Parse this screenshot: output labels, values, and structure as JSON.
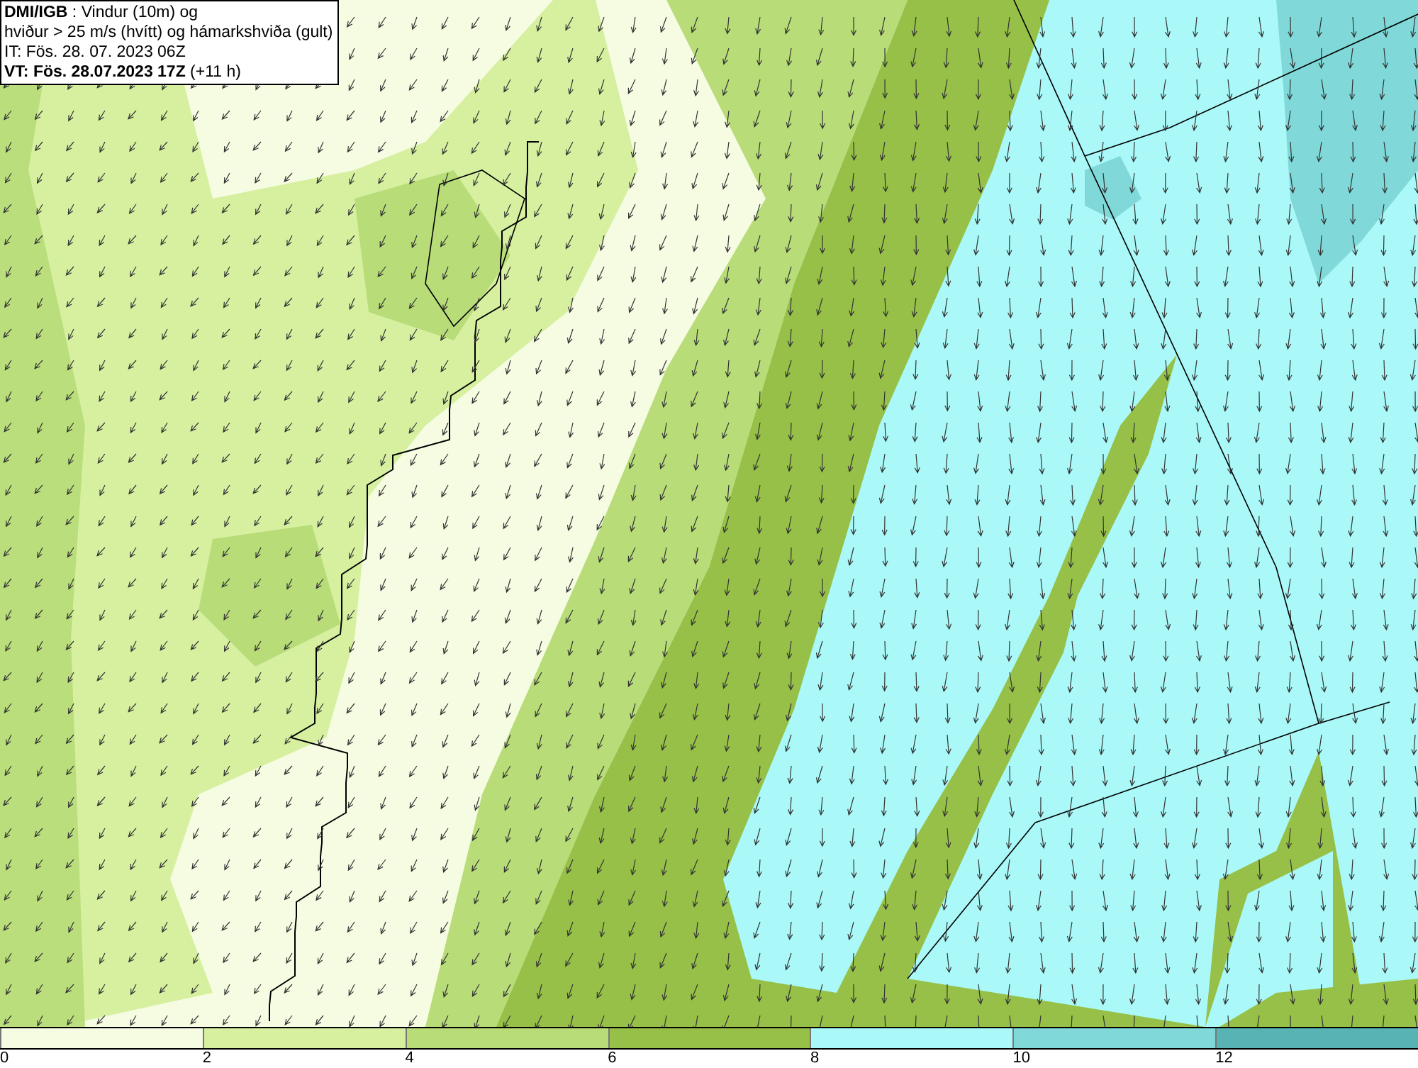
{
  "info_box": {
    "lines": [
      "**DMI/IGB** : Vindur (10m) og",
      "hviður > 25 m/s (hvítt) og hámarkshviða (gult)",
      "IT: Fös. 28. 07. 2023 06Z",
      "**VT: Fös. 28.07.2023 17Z** (+11 h)"
    ]
  },
  "legend": {
    "bins": [
      {
        "color": "#f5fce2"
      },
      {
        "color": "#d6f0a0"
      },
      {
        "color": "#b7dc78"
      },
      {
        "color": "#96c048"
      },
      {
        "color": "#aaf8f8"
      },
      {
        "color": "#80d8d8"
      },
      {
        "color": "#58b4b4"
      }
    ],
    "ticks": [
      "0",
      "2",
      "4",
      "6",
      "8",
      "10",
      "12"
    ]
  }
}
